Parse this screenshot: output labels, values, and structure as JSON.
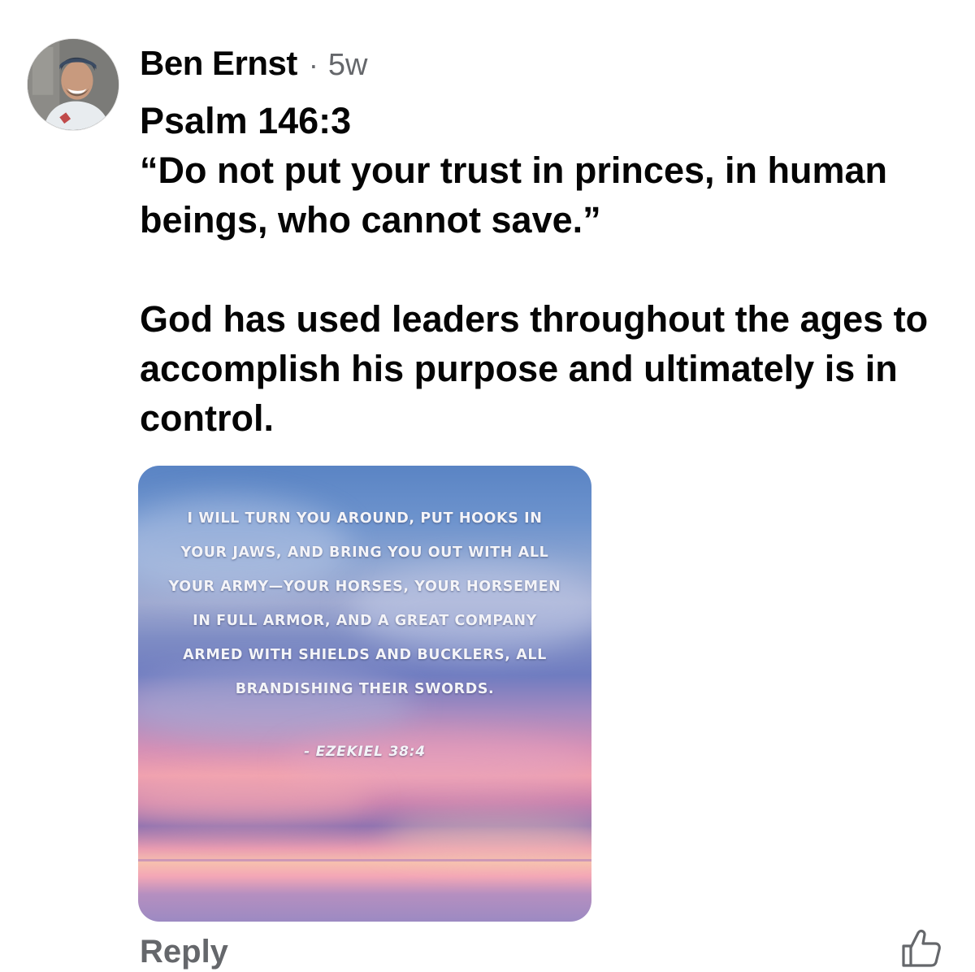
{
  "comment": {
    "author": {
      "name": "Ben Ernst",
      "avatar_icon": "profile-photo"
    },
    "separator": "·",
    "timestamp": "5w",
    "body": {
      "paragraph_1": "Psalm 146:3\n“Do not put your trust in princes, in human beings, who cannot save.”",
      "paragraph_2": "God has used leaders throughout the ages to accomplish his purpose and ultimately is in control."
    },
    "attachment": {
      "verse": "I will turn you around, put hooks in your jaws, and bring you out with all your army—your horses, your horsemen in full armor, and a great company armed with shields and bucklers, all brandishing their swords.",
      "reference": "- Ezekiel 38:4"
    },
    "actions": {
      "reply_label": "Reply",
      "like_icon": "thumbs-up-icon"
    }
  },
  "colors": {
    "text_primary": "#050505",
    "text_secondary": "#65676b"
  }
}
